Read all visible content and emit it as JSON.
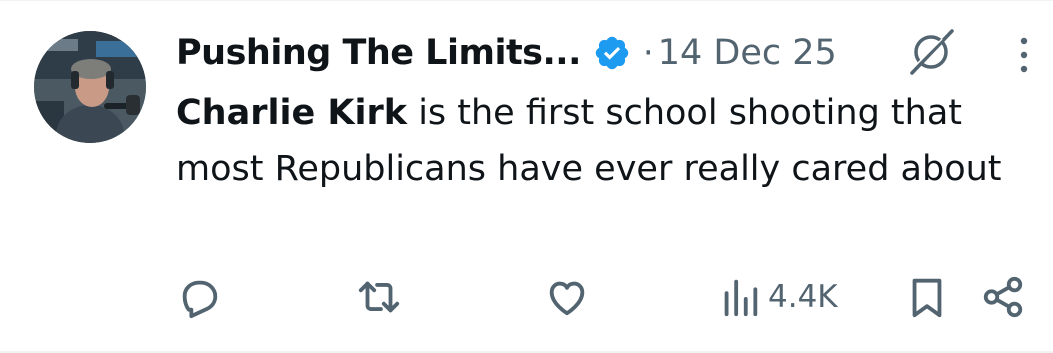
{
  "post": {
    "display_name": "Pushing The Limits...",
    "verified_icon": "verified-badge-icon",
    "separator": "·",
    "timestamp": "14 Dec 25",
    "mention": "Charlie Kirk",
    "text_after_mention": " is the first school shooting that most Republicans have ever really cared about"
  },
  "actions": {
    "reply_icon": "reply-icon",
    "repost_icon": "repost-icon",
    "like_icon": "like-icon",
    "views_icon": "views-icon",
    "views_count": "4.4K",
    "bookmark_icon": "bookmark-icon",
    "share_icon": "share-icon"
  },
  "header_icons": {
    "grok": "grok-icon",
    "more": "more-icon"
  },
  "colors": {
    "text": "#0f1419",
    "secondary": "#536471",
    "verified": "#1d9bf0",
    "border": "#eff3f4"
  }
}
